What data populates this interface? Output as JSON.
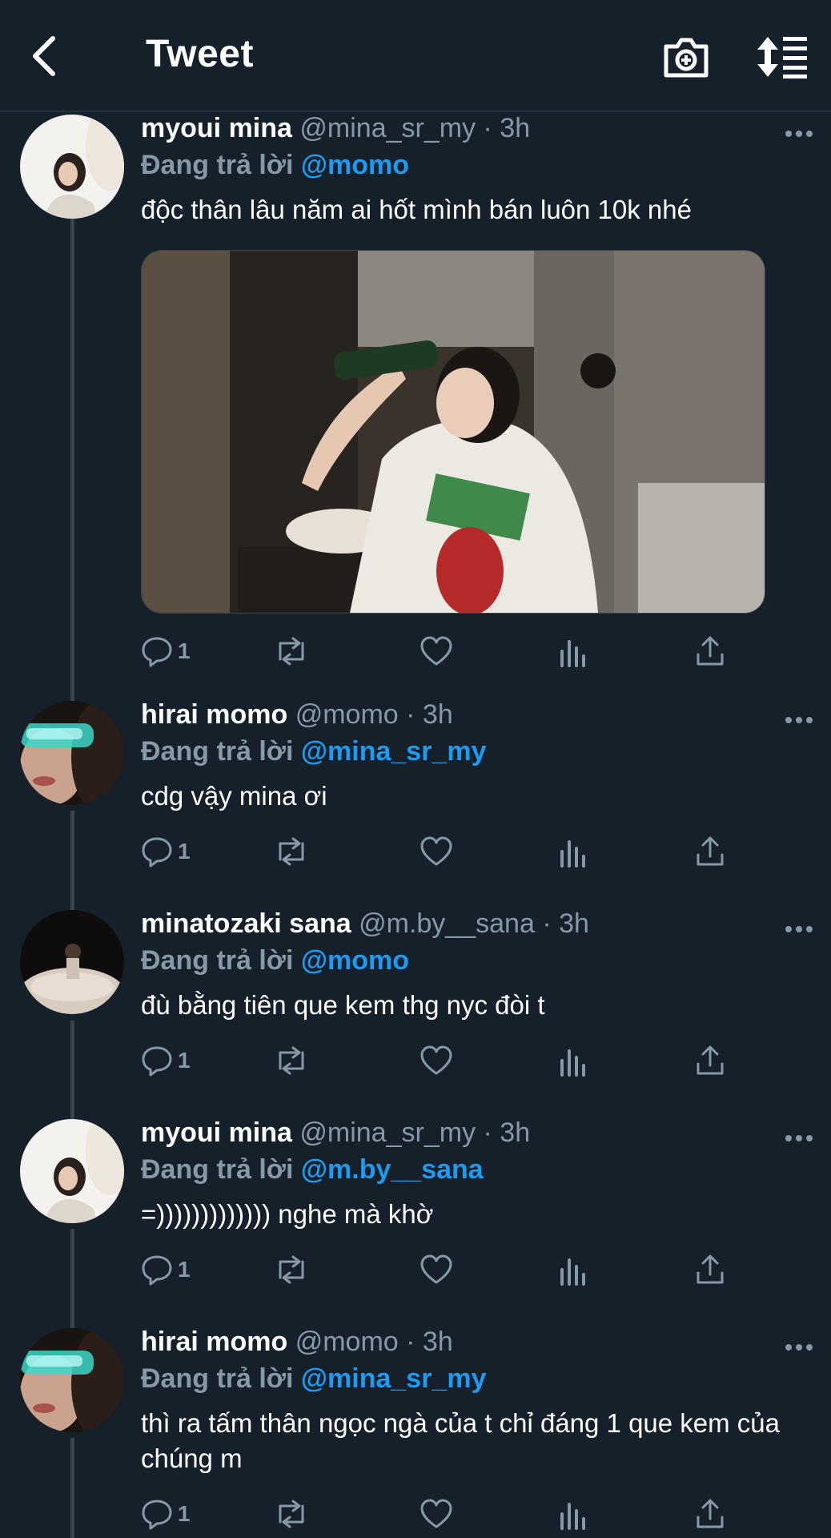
{
  "header": {
    "title": "Tweet",
    "back_icon": "chevron-left-icon",
    "camera_icon": "camera-plus-icon",
    "sort_icon": "sort-icon"
  },
  "reply_prefix": "Đang trả lời",
  "tweets": [
    {
      "name": "myoui mina",
      "handle": "@mina_sr_my",
      "time": "3h",
      "reply_to": "@momo",
      "text": "độc thân lâu năm ai hốt mình bán luôn 10k nhé",
      "reply_count": "1",
      "has_media": true
    },
    {
      "name": "hirai momo",
      "handle": "@momo",
      "time": "3h",
      "reply_to": "@mina_sr_my",
      "text": "cdg vậy mina ơi",
      "reply_count": "1"
    },
    {
      "name": "minatozaki sana",
      "handle": "@m.by__sana",
      "time": "3h",
      "reply_to": "@momo",
      "text": "đù bằng tiên que kem thg nyc đòi t",
      "reply_count": "1"
    },
    {
      "name": "myoui mina",
      "handle": "@mina_sr_my",
      "time": "3h",
      "reply_to": "@m.by__sana",
      "text": "=))))))))))))) nghe mà khờ",
      "reply_count": "1"
    },
    {
      "name": "hirai momo",
      "handle": "@momo",
      "time": "3h",
      "reply_to": "@mina_sr_my",
      "text": "thì ra tấm thân ngọc ngà của t chỉ đáng 1 que kem của chúng m",
      "reply_count": "1"
    }
  ],
  "colors": {
    "background": "#15202b",
    "secondary_text": "#8899a6",
    "mention": "#1d9bf0"
  }
}
